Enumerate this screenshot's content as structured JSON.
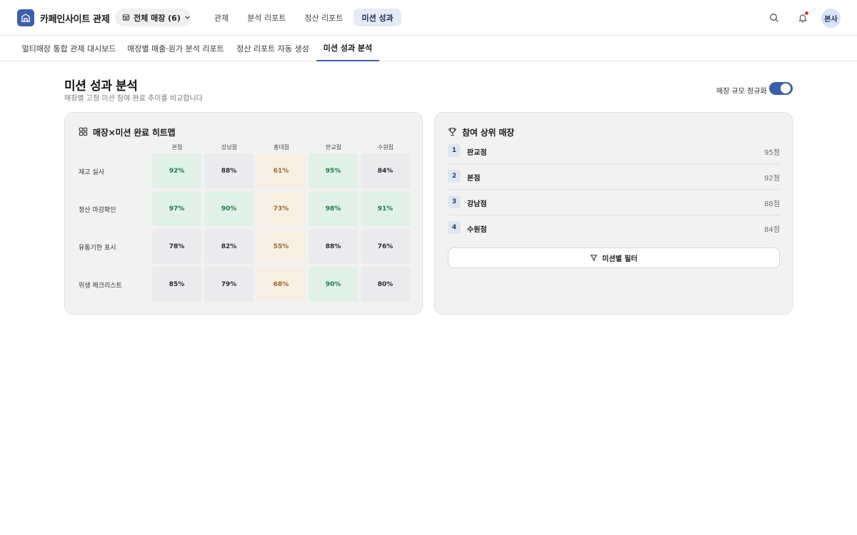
{
  "header": {
    "app_title": "카페인사이트 관제",
    "store_selector": "전체 매장 (6)",
    "nav": [
      "관제",
      "분석 리포트",
      "정산 리포트",
      "미션 성과"
    ],
    "active_nav": "미션 성과",
    "avatar": "본사",
    "has_notification": true,
    "accent_color": "#3d5fa8"
  },
  "subtabs": {
    "items": [
      "멀티매장 통합 관제 대시보드",
      "매장별 매출·원가 분석 리포트",
      "정산 리포트 자동 생성",
      "미션 성과 분석"
    ],
    "active": "미션 성과 분석"
  },
  "page": {
    "title": "미션 성과 분석",
    "subtitle": "매장별 고정 미션 참여·완료 추이를 비교합니다",
    "toggle_label": "매장 규모 정규화",
    "toggle_on": true
  },
  "heatmap": {
    "title": "매장×미션 완료 히트맵",
    "columns": [
      "본점",
      "강남점",
      "홍대점",
      "판교점",
      "수원점"
    ],
    "rows": [
      {
        "label": "재고 실사",
        "cells": [
          {
            "value": "92%",
            "level": "high"
          },
          {
            "value": "88%",
            "level": "mid"
          },
          {
            "value": "61%",
            "level": "low"
          },
          {
            "value": "95%",
            "level": "high"
          },
          {
            "value": "84%",
            "level": "mid"
          }
        ]
      },
      {
        "label": "정산 마감확인",
        "cells": [
          {
            "value": "97%",
            "level": "high"
          },
          {
            "value": "90%",
            "level": "high"
          },
          {
            "value": "73%",
            "level": "low"
          },
          {
            "value": "98%",
            "level": "high"
          },
          {
            "value": "91%",
            "level": "high"
          }
        ]
      },
      {
        "label": "유통기한 표시",
        "cells": [
          {
            "value": "78%",
            "level": "mid"
          },
          {
            "value": "82%",
            "level": "mid"
          },
          {
            "value": "55%",
            "level": "low"
          },
          {
            "value": "88%",
            "level": "mid"
          },
          {
            "value": "76%",
            "level": "mid"
          }
        ]
      },
      {
        "label": "위생 체크리스트",
        "cells": [
          {
            "value": "85%",
            "level": "mid"
          },
          {
            "value": "79%",
            "level": "mid"
          },
          {
            "value": "68%",
            "level": "low"
          },
          {
            "value": "90%",
            "level": "high"
          },
          {
            "value": "80%",
            "level": "mid"
          }
        ]
      }
    ],
    "colors": {
      "high": "#e1f1e8",
      "mid": "#ebebed",
      "low": "#f7efe4"
    }
  },
  "ranking": {
    "title": "참여 상위 매장",
    "items": [
      {
        "rank": "1",
        "name": "판교점",
        "score": "95점"
      },
      {
        "rank": "2",
        "name": "본점",
        "score": "92점"
      },
      {
        "rank": "3",
        "name": "강남점",
        "score": "88점"
      },
      {
        "rank": "4",
        "name": "수원점",
        "score": "84점"
      }
    ],
    "filter_button": "미션별 필터"
  }
}
